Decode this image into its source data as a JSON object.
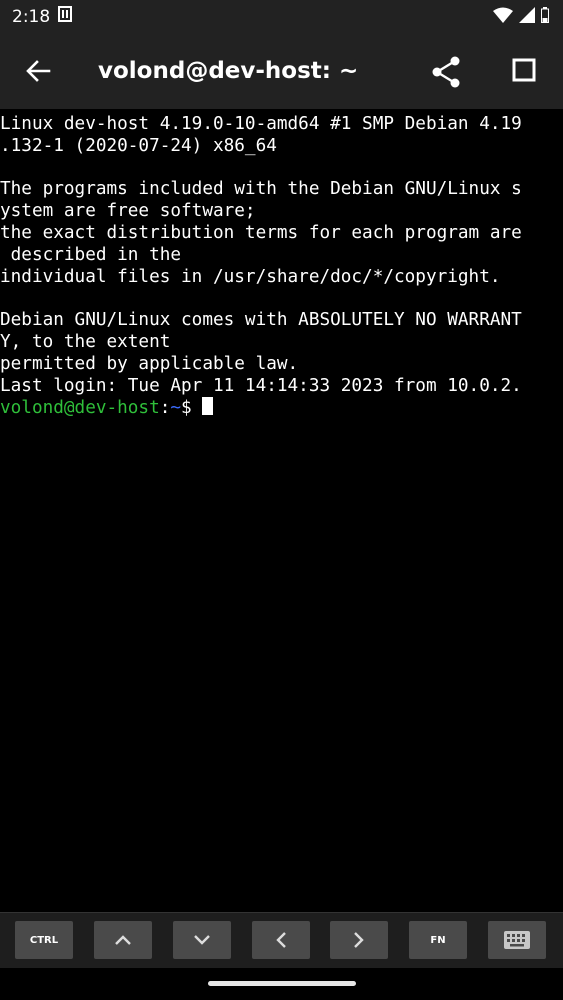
{
  "status_bar": {
    "time": "2:18",
    "icons": [
      "sim-card-icon",
      "wifi-icon",
      "signal-icon",
      "battery-icon"
    ]
  },
  "app_bar": {
    "title": "volond@dev-host: ~",
    "icons": [
      "back-arrow-icon",
      "share-icon",
      "stop-square-icon"
    ]
  },
  "terminal": {
    "lines": [
      "Linux dev-host 4.19.0-10-amd64 #1 SMP Debian 4.19",
      ".132-1 (2020-07-24) x86_64",
      "",
      "The programs included with the Debian GNU/Linux s",
      "ystem are free software;",
      "the exact distribution terms for each program are",
      " described in the",
      "individual files in /usr/share/doc/*/copyright.",
      "",
      "Debian GNU/Linux comes with ABSOLUTELY NO WARRANT",
      "Y, to the extent",
      "permitted by applicable law.",
      "Last login: Tue Apr 11 14:14:33 2023 from 10.0.2."
    ],
    "prompt": {
      "user_host": "volond@dev-host",
      "separator": ":",
      "path": "~",
      "symbol": "$ "
    },
    "colors": {
      "background": "#000000",
      "text": "#ffffff",
      "prompt_user": "#2fbf3a",
      "prompt_path": "#3b6cff"
    }
  },
  "key_bar": {
    "ctrl_label": "CTRL",
    "fn_label": "FN",
    "icons": [
      "chevron-up-icon",
      "chevron-down-icon",
      "chevron-left-icon",
      "chevron-right-icon",
      "keyboard-icon"
    ]
  }
}
